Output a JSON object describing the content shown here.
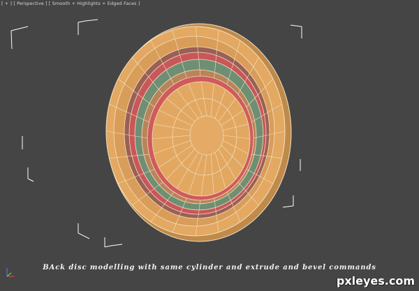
{
  "viewport": {
    "label": "[ + ] [ Perspective ] [ Smooth + Highlights + Edged Faces ]",
    "background": "#454545"
  },
  "model": {
    "name": "back-disc",
    "colors": {
      "orange": "#e0a560",
      "orange_dark": "#b98445",
      "red": "#c9565a",
      "green": "#6f8f74",
      "edge": "#f4e6cc"
    }
  },
  "caption": "BAck disc modelling with same cylinder and extrude and bevel commands",
  "watermark": "pxleyes.com"
}
